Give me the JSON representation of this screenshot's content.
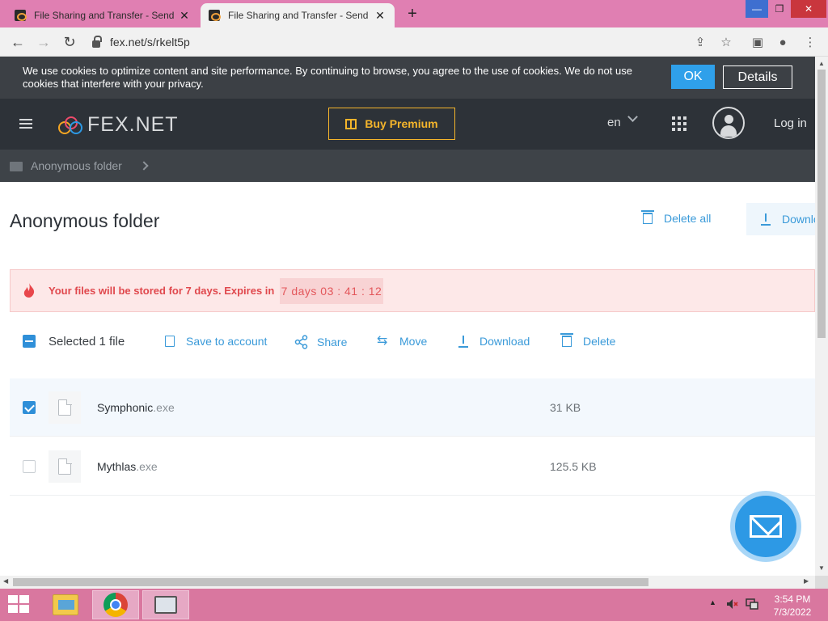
{
  "browser": {
    "tabs": [
      {
        "title": "File Sharing and Transfer - Send",
        "active": false
      },
      {
        "title": "File Sharing and Transfer - Send",
        "active": true
      }
    ],
    "new_tab": "+",
    "window": {
      "minimize": "—",
      "maximize": "❐",
      "close": "✕"
    },
    "url": "fex.net/s/rkelt5p"
  },
  "cookie": {
    "text": "We use cookies to optimize content and site performance. By continuing to browse, you agree to the use of cookies. We do not use cookies that interfere with your privacy.",
    "ok_label": "OK",
    "details_label": "Details"
  },
  "header": {
    "logo_text": "FEX.NET",
    "premium_label": "Buy Premium",
    "language": "en",
    "login_label": "Log in",
    "accent": "#f5b52b"
  },
  "breadcrumb": {
    "label": "Anonymous folder"
  },
  "main": {
    "title": "Anonymous folder",
    "delete_all_label": "Delete all",
    "download_top_label": "Download",
    "expiry": {
      "message": "Your files will be stored for 7 days. Expires in",
      "timer": "7 days  03 : 41 : 12",
      "color": "#e0484d"
    },
    "actions": {
      "selected_text": "Selected 1 file",
      "save_label": "Save to account",
      "share_label": "Share",
      "move_label": "Move",
      "download_label": "Download",
      "delete_label": "Delete"
    },
    "files": [
      {
        "name": "Symphonic",
        "ext": ".exe",
        "size": "31 KB",
        "checked": true
      },
      {
        "name": "Mythlas",
        "ext": ".exe",
        "size": "125.5 KB",
        "checked": false
      }
    ]
  },
  "taskbar": {
    "time": "3:54 PM",
    "date": "7/3/2022"
  }
}
